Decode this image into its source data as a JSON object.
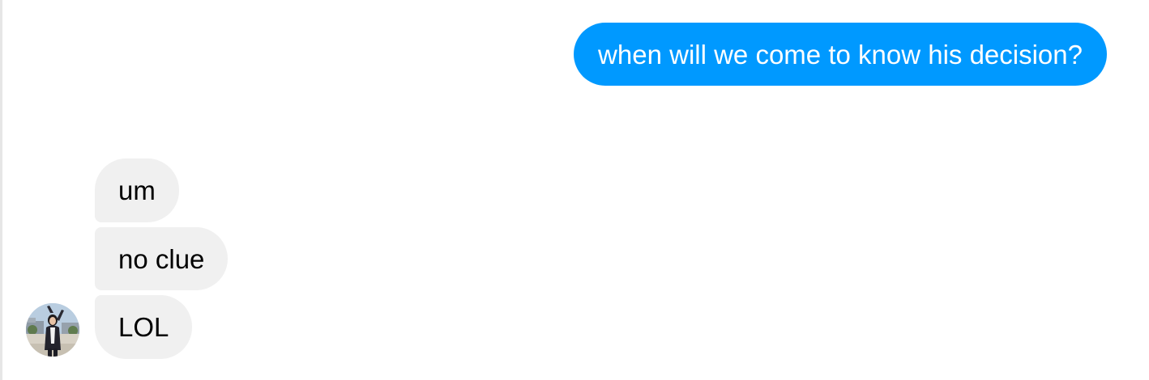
{
  "conversation": {
    "outgoing": [
      {
        "text": "when will we come to know his decision?"
      }
    ],
    "incoming": [
      {
        "text": "um"
      },
      {
        "text": "no clue"
      },
      {
        "text": "LOL"
      }
    ],
    "avatar": {
      "icon": "contact-avatar-photo"
    }
  },
  "colors": {
    "outgoing_bubble": "#0099ff",
    "outgoing_text": "#ffffff",
    "incoming_bubble": "#f0f0f0",
    "incoming_text": "#000000"
  }
}
